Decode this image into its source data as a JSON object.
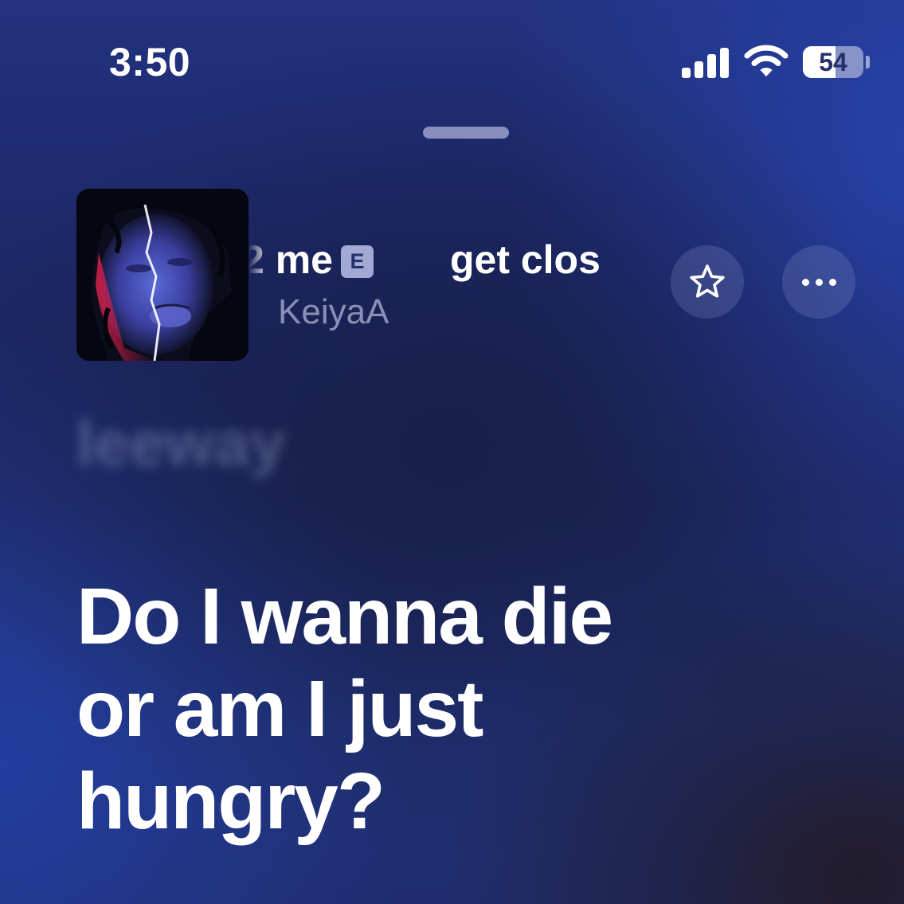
{
  "status_bar": {
    "time": "3:50",
    "battery_level": "54",
    "battery_fraction": 0.54,
    "icons": [
      "cellular-signal-icon",
      "wifi-icon",
      "battery-icon"
    ]
  },
  "now_playing": {
    "title_partial": "2 me",
    "explicit_badge": "E",
    "next_title_partial": "get clos",
    "artist": "KeiyaA",
    "artwork_icon": "album-artwork",
    "favorite_icon": "star-icon",
    "more_icon": "ellipsis-icon"
  },
  "lyrics": {
    "previous_line": "leeway",
    "current_lines": [
      "Do I wanna die",
      "or am I just",
      "hungry?"
    ]
  },
  "colors": {
    "text_primary": "#ffffff",
    "text_secondary": "#cdd4f0",
    "background_blue": "#1f2d6e"
  }
}
